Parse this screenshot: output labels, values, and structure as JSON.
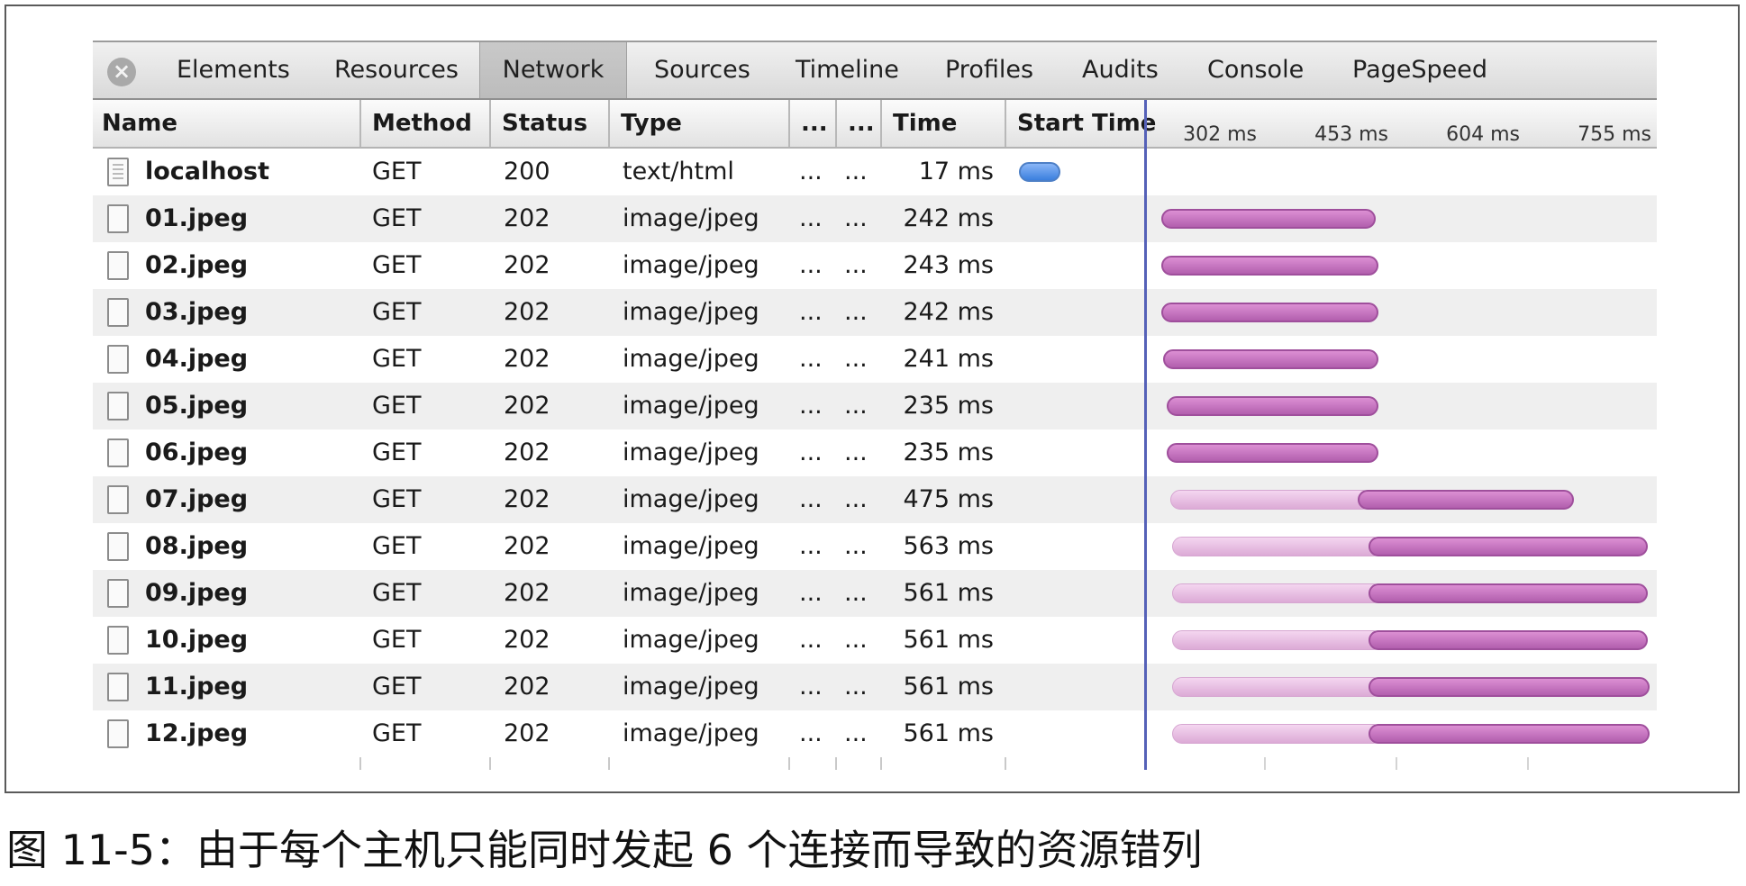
{
  "tabs": [
    {
      "label": "Elements",
      "active": false
    },
    {
      "label": "Resources",
      "active": false
    },
    {
      "label": "Network",
      "active": true
    },
    {
      "label": "Sources",
      "active": false
    },
    {
      "label": "Timeline",
      "active": false
    },
    {
      "label": "Profiles",
      "active": false
    },
    {
      "label": "Audits",
      "active": false
    },
    {
      "label": "Console",
      "active": false
    },
    {
      "label": "PageSpeed",
      "active": false
    }
  ],
  "close_icon": "close-circle-icon",
  "columns": {
    "name": "Name",
    "method": "Method",
    "status": "Status",
    "type": "Type",
    "col5": "...",
    "col6": "...",
    "time": "Time",
    "start_time": "Start Time"
  },
  "timeline_ticks": [
    "302 ms",
    "453 ms",
    "604 ms",
    "755 ms"
  ],
  "rows": [
    {
      "name": "localhost",
      "method": "GET",
      "status": "200",
      "type": "text/html",
      "c5": "...",
      "c6": "...",
      "time": "17 ms"
    },
    {
      "name": "01.jpeg",
      "method": "GET",
      "status": "202",
      "type": "image/jpeg",
      "c5": "...",
      "c6": "...",
      "time": "242 ms"
    },
    {
      "name": "02.jpeg",
      "method": "GET",
      "status": "202",
      "type": "image/jpeg",
      "c5": "...",
      "c6": "...",
      "time": "243 ms"
    },
    {
      "name": "03.jpeg",
      "method": "GET",
      "status": "202",
      "type": "image/jpeg",
      "c5": "...",
      "c6": "...",
      "time": "242 ms"
    },
    {
      "name": "04.jpeg",
      "method": "GET",
      "status": "202",
      "type": "image/jpeg",
      "c5": "...",
      "c6": "...",
      "time": "241 ms"
    },
    {
      "name": "05.jpeg",
      "method": "GET",
      "status": "202",
      "type": "image/jpeg",
      "c5": "...",
      "c6": "...",
      "time": "235 ms"
    },
    {
      "name": "06.jpeg",
      "method": "GET",
      "status": "202",
      "type": "image/jpeg",
      "c5": "...",
      "c6": "...",
      "time": "235 ms"
    },
    {
      "name": "07.jpeg",
      "method": "GET",
      "status": "202",
      "type": "image/jpeg",
      "c5": "...",
      "c6": "...",
      "time": "475 ms"
    },
    {
      "name": "08.jpeg",
      "method": "GET",
      "status": "202",
      "type": "image/jpeg",
      "c5": "...",
      "c6": "...",
      "time": "563 ms"
    },
    {
      "name": "09.jpeg",
      "method": "GET",
      "status": "202",
      "type": "image/jpeg",
      "c5": "...",
      "c6": "...",
      "time": "561 ms"
    },
    {
      "name": "10.jpeg",
      "method": "GET",
      "status": "202",
      "type": "image/jpeg",
      "c5": "...",
      "c6": "...",
      "time": "561 ms"
    },
    {
      "name": "11.jpeg",
      "method": "GET",
      "status": "202",
      "type": "image/jpeg",
      "c5": "...",
      "c6": "...",
      "time": "561 ms"
    },
    {
      "name": "12.jpeg",
      "method": "GET",
      "status": "202",
      "type": "image/jpeg",
      "c5": "...",
      "c6": "...",
      "time": "561 ms"
    }
  ],
  "colors": {
    "receive_bar": "#b25fae",
    "wait_bar": "#e8c0e4",
    "html_bar": "#3b7fde",
    "start_line": "#5561b8"
  },
  "caption": "图 11-5：由于每个主机只能同时发起 6 个连接而导致的资源错列"
}
